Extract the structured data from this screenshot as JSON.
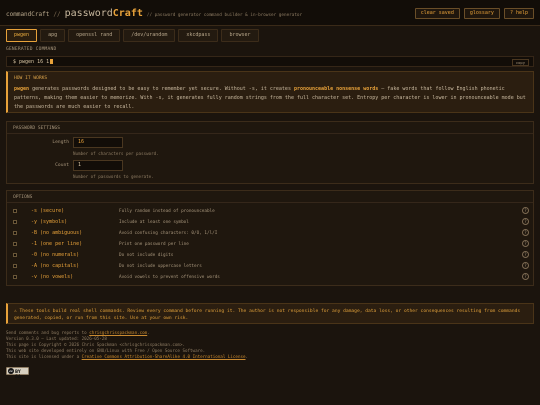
{
  "header": {
    "app": "commandCraft",
    "sep": "//",
    "tool_prefix": "password",
    "tool_suffix": "Craft",
    "desc": "// password generator command builder & in-browser generator",
    "buttons": [
      "clear saved",
      "glossary",
      "? help"
    ]
  },
  "tabs": [
    {
      "label": "pwgen",
      "active": true
    },
    {
      "label": "apg",
      "active": false
    },
    {
      "label": "openssl rand",
      "active": false
    },
    {
      "label": "/dev/urandom",
      "active": false
    },
    {
      "label": "xkcdpass",
      "active": false
    },
    {
      "label": "browser",
      "active": false
    }
  ],
  "generated": {
    "label": "GENERATED COMMAND",
    "command": "$ pwgen 16 1",
    "copy_label": "copy"
  },
  "how": {
    "title": "HOW IT WORKS",
    "p1_cmd": "pwgen",
    "p1_a": " generates passwords designed to be easy to remember yet secure. Without -s, it creates ",
    "p1_hl": "pronounceable nonsense words",
    "p1_b": " — fake words that follow English phonetic patterns, making them easier to memorize. With -s, it generates fully random strings from the full character set. Entropy per character is lower in pronounceable mode but the passwords are much easier to recall."
  },
  "settings": {
    "title": "PASSWORD SETTINGS",
    "length_label": "Length",
    "length_value": "16",
    "length_hint": "Number of characters per password.",
    "count_label": "Count",
    "count_value": "1",
    "count_hint": "Number of passwords to generate."
  },
  "options": {
    "title": "OPTIONS",
    "help_icon_text": "?",
    "items": [
      {
        "flag": "-s (secure)",
        "desc": "Fully random instead of pronounceable"
      },
      {
        "flag": "-y (symbols)",
        "desc": "Include at least one symbol"
      },
      {
        "flag": "-B (no ambiguous)",
        "desc": "Avoid confusing characters: 0/O, 1/l/I"
      },
      {
        "flag": "-1 (one per line)",
        "desc": "Print one password per line"
      },
      {
        "flag": "-0 (no numerals)",
        "desc": "Do not include digits"
      },
      {
        "flag": "-A (no capitals)",
        "desc": "Do not include uppercase letters"
      },
      {
        "flag": "-v (no vowels)",
        "desc": "Avoid vowels to prevent offensive words"
      }
    ]
  },
  "warning": "⚠ These tools build real shell commands. Review every command before running it. The author is not responsible for any damage, data loss, or other consequences resulting from commands generated, copied, or run from this site. Use at your own risk.",
  "footer": {
    "l1a": "Send comments and bug reports to ",
    "l1_link": "chrisgchrisspackman.com",
    "l1b": ".",
    "l2": "Version 0.3.0 — Last updated: 2026-05-28",
    "l3": "This page is Copyright © 2026 Chris Spackman <chrisgchrisspackman.com>.",
    "l4": "This web site developed entirely on GNU/Linux with Free / Open Source Software.",
    "l5a": "This site is licensed under a ",
    "l5_link": "Creative Commons Attribution-ShareAlike 4.0 International License",
    "l5b": ".",
    "badge_text": "cc by-sa"
  },
  "colors": {
    "accent": "#e8a23a",
    "background": "#1b140d",
    "panel": "#1f170e",
    "callout": "#2b1e10"
  }
}
